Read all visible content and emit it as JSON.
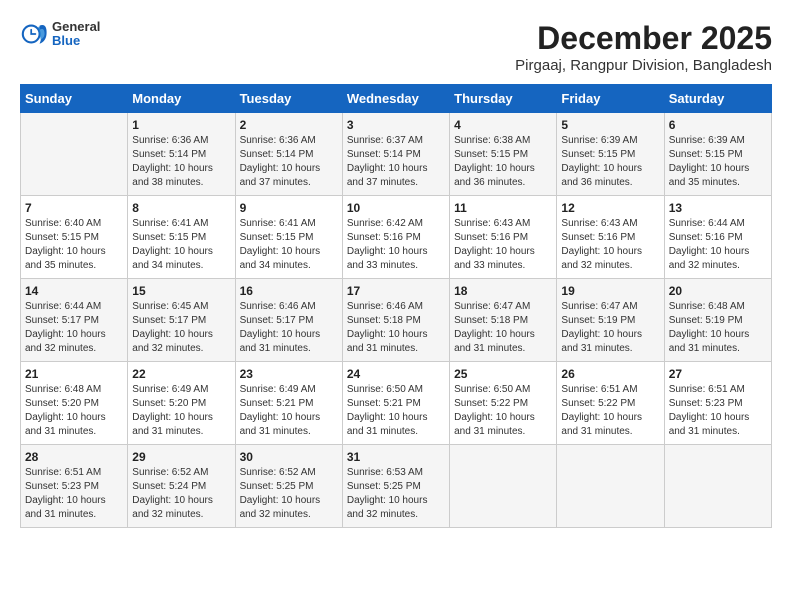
{
  "logo": {
    "general": "General",
    "blue": "Blue"
  },
  "header": {
    "title": "December 2025",
    "subtitle": "Pirgaaj, Rangpur Division, Bangladesh"
  },
  "weekdays": [
    "Sunday",
    "Monday",
    "Tuesday",
    "Wednesday",
    "Thursday",
    "Friday",
    "Saturday"
  ],
  "weeks": [
    [
      {
        "day": "",
        "info": ""
      },
      {
        "day": "1",
        "info": "Sunrise: 6:36 AM\nSunset: 5:14 PM\nDaylight: 10 hours\nand 38 minutes."
      },
      {
        "day": "2",
        "info": "Sunrise: 6:36 AM\nSunset: 5:14 PM\nDaylight: 10 hours\nand 37 minutes."
      },
      {
        "day": "3",
        "info": "Sunrise: 6:37 AM\nSunset: 5:14 PM\nDaylight: 10 hours\nand 37 minutes."
      },
      {
        "day": "4",
        "info": "Sunrise: 6:38 AM\nSunset: 5:15 PM\nDaylight: 10 hours\nand 36 minutes."
      },
      {
        "day": "5",
        "info": "Sunrise: 6:39 AM\nSunset: 5:15 PM\nDaylight: 10 hours\nand 36 minutes."
      },
      {
        "day": "6",
        "info": "Sunrise: 6:39 AM\nSunset: 5:15 PM\nDaylight: 10 hours\nand 35 minutes."
      }
    ],
    [
      {
        "day": "7",
        "info": "Sunrise: 6:40 AM\nSunset: 5:15 PM\nDaylight: 10 hours\nand 35 minutes."
      },
      {
        "day": "8",
        "info": "Sunrise: 6:41 AM\nSunset: 5:15 PM\nDaylight: 10 hours\nand 34 minutes."
      },
      {
        "day": "9",
        "info": "Sunrise: 6:41 AM\nSunset: 5:15 PM\nDaylight: 10 hours\nand 34 minutes."
      },
      {
        "day": "10",
        "info": "Sunrise: 6:42 AM\nSunset: 5:16 PM\nDaylight: 10 hours\nand 33 minutes."
      },
      {
        "day": "11",
        "info": "Sunrise: 6:43 AM\nSunset: 5:16 PM\nDaylight: 10 hours\nand 33 minutes."
      },
      {
        "day": "12",
        "info": "Sunrise: 6:43 AM\nSunset: 5:16 PM\nDaylight: 10 hours\nand 32 minutes."
      },
      {
        "day": "13",
        "info": "Sunrise: 6:44 AM\nSunset: 5:16 PM\nDaylight: 10 hours\nand 32 minutes."
      }
    ],
    [
      {
        "day": "14",
        "info": "Sunrise: 6:44 AM\nSunset: 5:17 PM\nDaylight: 10 hours\nand 32 minutes."
      },
      {
        "day": "15",
        "info": "Sunrise: 6:45 AM\nSunset: 5:17 PM\nDaylight: 10 hours\nand 32 minutes."
      },
      {
        "day": "16",
        "info": "Sunrise: 6:46 AM\nSunset: 5:17 PM\nDaylight: 10 hours\nand 31 minutes."
      },
      {
        "day": "17",
        "info": "Sunrise: 6:46 AM\nSunset: 5:18 PM\nDaylight: 10 hours\nand 31 minutes."
      },
      {
        "day": "18",
        "info": "Sunrise: 6:47 AM\nSunset: 5:18 PM\nDaylight: 10 hours\nand 31 minutes."
      },
      {
        "day": "19",
        "info": "Sunrise: 6:47 AM\nSunset: 5:19 PM\nDaylight: 10 hours\nand 31 minutes."
      },
      {
        "day": "20",
        "info": "Sunrise: 6:48 AM\nSunset: 5:19 PM\nDaylight: 10 hours\nand 31 minutes."
      }
    ],
    [
      {
        "day": "21",
        "info": "Sunrise: 6:48 AM\nSunset: 5:20 PM\nDaylight: 10 hours\nand 31 minutes."
      },
      {
        "day": "22",
        "info": "Sunrise: 6:49 AM\nSunset: 5:20 PM\nDaylight: 10 hours\nand 31 minutes."
      },
      {
        "day": "23",
        "info": "Sunrise: 6:49 AM\nSunset: 5:21 PM\nDaylight: 10 hours\nand 31 minutes."
      },
      {
        "day": "24",
        "info": "Sunrise: 6:50 AM\nSunset: 5:21 PM\nDaylight: 10 hours\nand 31 minutes."
      },
      {
        "day": "25",
        "info": "Sunrise: 6:50 AM\nSunset: 5:22 PM\nDaylight: 10 hours\nand 31 minutes."
      },
      {
        "day": "26",
        "info": "Sunrise: 6:51 AM\nSunset: 5:22 PM\nDaylight: 10 hours\nand 31 minutes."
      },
      {
        "day": "27",
        "info": "Sunrise: 6:51 AM\nSunset: 5:23 PM\nDaylight: 10 hours\nand 31 minutes."
      }
    ],
    [
      {
        "day": "28",
        "info": "Sunrise: 6:51 AM\nSunset: 5:23 PM\nDaylight: 10 hours\nand 31 minutes."
      },
      {
        "day": "29",
        "info": "Sunrise: 6:52 AM\nSunset: 5:24 PM\nDaylight: 10 hours\nand 32 minutes."
      },
      {
        "day": "30",
        "info": "Sunrise: 6:52 AM\nSunset: 5:25 PM\nDaylight: 10 hours\nand 32 minutes."
      },
      {
        "day": "31",
        "info": "Sunrise: 6:53 AM\nSunset: 5:25 PM\nDaylight: 10 hours\nand 32 minutes."
      },
      {
        "day": "",
        "info": ""
      },
      {
        "day": "",
        "info": ""
      },
      {
        "day": "",
        "info": ""
      }
    ]
  ]
}
